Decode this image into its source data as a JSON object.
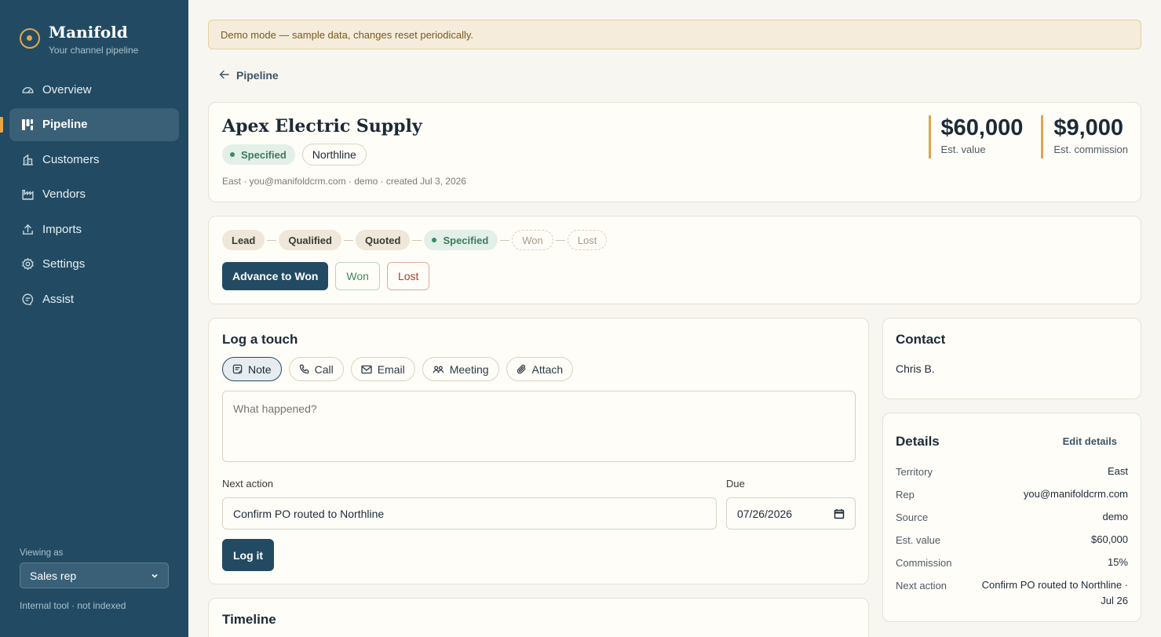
{
  "brand": {
    "name": "Manifold",
    "tagline": "Your channel pipeline"
  },
  "sidebar": {
    "items": [
      {
        "label": "Overview",
        "icon": "gauge-icon"
      },
      {
        "label": "Pipeline",
        "icon": "kanban-icon",
        "active": true
      },
      {
        "label": "Customers",
        "icon": "building-icon"
      },
      {
        "label": "Vendors",
        "icon": "factory-icon"
      },
      {
        "label": "Imports",
        "icon": "upload-icon"
      },
      {
        "label": "Settings",
        "icon": "gear-icon"
      },
      {
        "label": "Assist",
        "icon": "chat-icon"
      }
    ],
    "viewing_label": "Viewing as",
    "role": "Sales rep",
    "footnote": "Internal tool · not indexed"
  },
  "banner": "Demo mode — sample data, changes reset periodically.",
  "back": {
    "label": "Pipeline"
  },
  "deal": {
    "title": "Apex Electric Supply",
    "status": "Specified",
    "vendor": "Northline",
    "meta": "East · you@manifoldcrm.com · demo · created Jul 3, 2026",
    "est_value": "$60,000",
    "est_value_label": "Est. value",
    "est_commission": "$9,000",
    "est_commission_label": "Est. commission"
  },
  "stages": [
    {
      "label": "Lead",
      "state": "done"
    },
    {
      "label": "Qualified",
      "state": "done"
    },
    {
      "label": "Quoted",
      "state": "done"
    },
    {
      "label": "Specified",
      "state": "current"
    },
    {
      "label": "Won",
      "state": "future"
    },
    {
      "label": "Lost",
      "state": "future"
    }
  ],
  "stage_actions": {
    "advance": "Advance to Won",
    "won": "Won",
    "lost": "Lost"
  },
  "log": {
    "title": "Log a touch",
    "types": [
      "Note",
      "Call",
      "Email",
      "Meeting",
      "Attach"
    ],
    "active_type": "Note",
    "placeholder": "What happened?",
    "next_action_label": "Next action",
    "next_action_value": "Confirm PO routed to Northline",
    "due_label": "Due",
    "due_value": "07/26/2026",
    "submit": "Log it"
  },
  "timeline": {
    "title": "Timeline"
  },
  "contact": {
    "title": "Contact",
    "name": "Chris B."
  },
  "details": {
    "title": "Details",
    "edit": "Edit details",
    "rows": [
      {
        "k": "Territory",
        "v": "East"
      },
      {
        "k": "Rep",
        "v": "you@manifoldcrm.com"
      },
      {
        "k": "Source",
        "v": "demo"
      },
      {
        "k": "Est. value",
        "v": "$60,000"
      },
      {
        "k": "Commission",
        "v": "15%"
      },
      {
        "k": "Next action",
        "v": "Confirm PO routed to Northline · Jul 26"
      }
    ]
  },
  "colors": {
    "sidebar": "#224b63",
    "accent": "#e7a646",
    "status_green": "#3d8a64",
    "danger": "#b23a2a"
  }
}
